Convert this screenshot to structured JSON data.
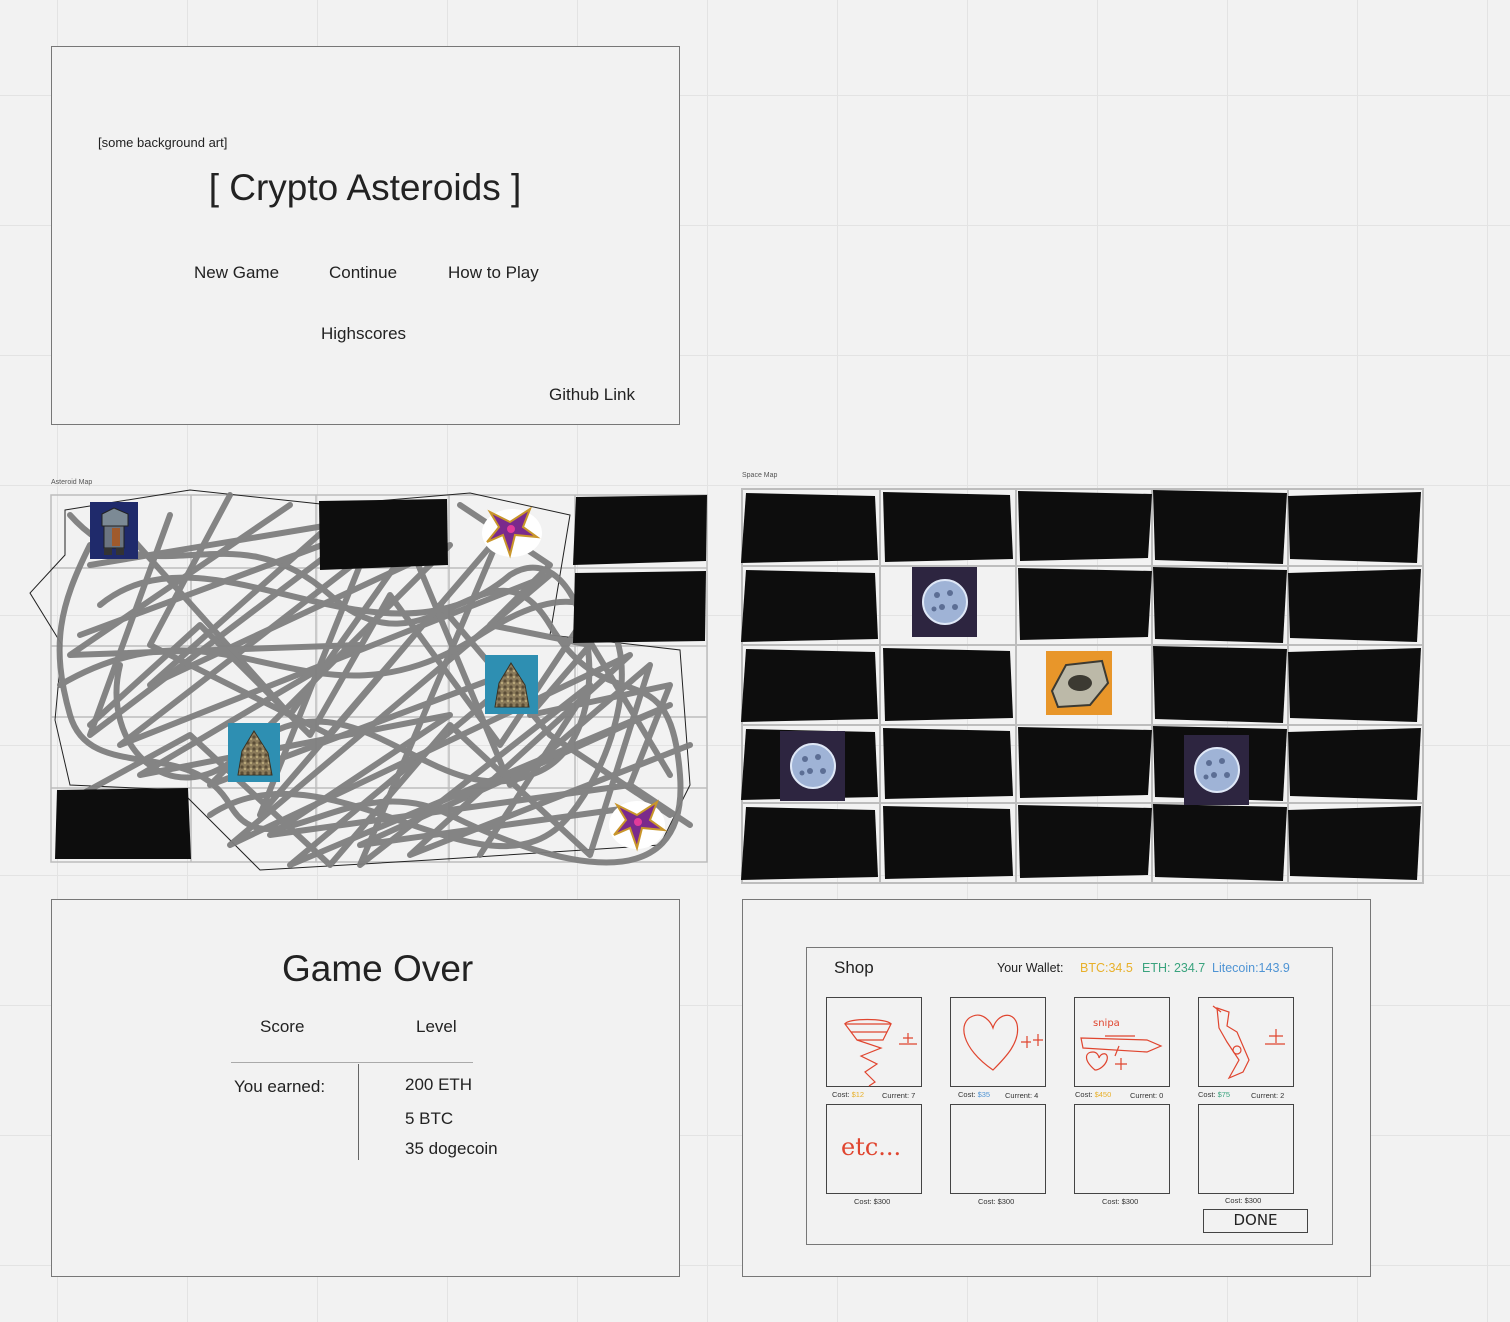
{
  "title_screen": {
    "bg_note": "[some background art]",
    "title": "[ Crypto Asteroids ]",
    "menu": [
      "New Game",
      "Continue",
      "How to Play"
    ],
    "highscores": "Highscores",
    "github": "Github Link"
  },
  "asteroid_map": {
    "label": "Asteroid Map",
    "grid": {
      "cols": 5,
      "rows": 5
    }
  },
  "space_map": {
    "label": "Space Map",
    "grid": {
      "cols": 5,
      "rows": 5
    }
  },
  "game_over": {
    "title": "Game Over",
    "col_score": "Score",
    "col_level": "Level",
    "earned_label": "You earned:",
    "earnings": [
      "200 ETH",
      "5 BTC",
      "35 dogecoin"
    ]
  },
  "shop": {
    "title": "Shop",
    "wallet_label": "Your Wallet:",
    "wallet": {
      "btc": "BTC:34.5",
      "eth": "ETH: 234.7",
      "ltc": "Litecoin:143.9"
    },
    "items": [
      {
        "cost_prefix": "Cost: ",
        "cost": "$12",
        "currency": "btc",
        "current": "Current: 7",
        "sketch": "tornado"
      },
      {
        "cost_prefix": "Cost: ",
        "cost": "$35",
        "currency": "ltc",
        "current": "Current: 4",
        "sketch": "heart"
      },
      {
        "cost_prefix": "Cost: ",
        "cost": "$450",
        "currency": "btc",
        "current": "Current: 0",
        "sketch": "sniper"
      },
      {
        "cost_prefix": "Cost: ",
        "cost": "$75",
        "currency": "eth",
        "current": "Current: 2",
        "sketch": "gun"
      },
      {
        "cost_prefix": "Cost: ",
        "cost": "$300",
        "currency": "",
        "current": "",
        "sketch": "etc"
      },
      {
        "cost_prefix": "Cost: ",
        "cost": "$300",
        "currency": "",
        "current": "",
        "sketch": "empty"
      },
      {
        "cost_prefix": "Cost: ",
        "cost": "$300",
        "currency": "",
        "current": "",
        "sketch": "empty"
      },
      {
        "cost_prefix": "Cost: ",
        "cost": "$300",
        "currency": "",
        "current": "",
        "sketch": "empty"
      }
    ],
    "sniper_note": "snipa",
    "etc_note": "etc...",
    "done": "DONE"
  },
  "colors": {
    "btc": "#e8b02a",
    "eth": "#3aa37e",
    "ltc": "#4f94d4",
    "sketch_red": "#e0452f",
    "scribble": "#7f7f7f"
  }
}
